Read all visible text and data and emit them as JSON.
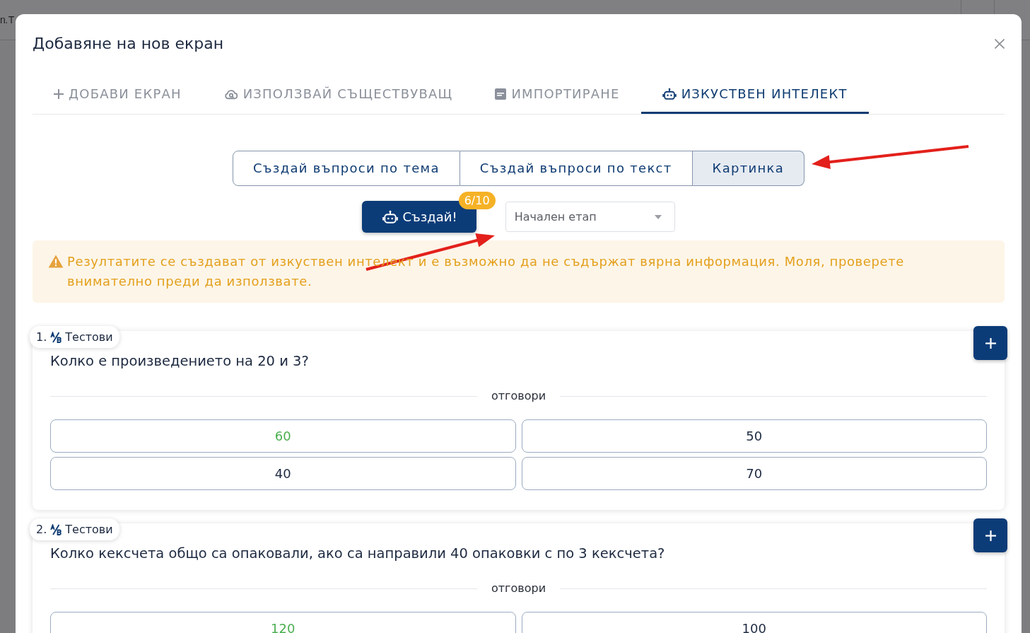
{
  "background_page": {
    "header_text": "n. T"
  },
  "dialog": {
    "title": "Добавяне на нов екран"
  },
  "tabs": [
    {
      "kind": "add",
      "label": "ДОБАВИ ЕКРАН",
      "selected": false
    },
    {
      "kind": "reuse",
      "label": "ИЗПОЛЗВАЙ СЪЩЕСТВУВАЩ",
      "selected": false
    },
    {
      "kind": "import",
      "label": "ИМПОРТИРАНЕ",
      "selected": false
    },
    {
      "kind": "ai",
      "label": "ИЗКУСТВЕН ИНТЕЛЕКТ",
      "selected": true
    }
  ],
  "mode_options": [
    {
      "label": "Създай въпроси по тема",
      "selected": false
    },
    {
      "label": "Създай въпроси по текст",
      "selected": false
    },
    {
      "label": "Картинка",
      "selected": true
    }
  ],
  "create_button": {
    "label": "Създай!",
    "badge": "6/10"
  },
  "stage_select": {
    "value": "Начален етап"
  },
  "warning": {
    "text": "Резултатите се създават от изкуствен интелект и е възможно да не съдържат вярна информация. Моля, проверете внимателно преди да използвате."
  },
  "questions": [
    {
      "number": "1.",
      "type": "Тестови",
      "text": "Колко е произведението на 20 и 3?",
      "answers_heading": "отговори",
      "answers": [
        {
          "text": "60",
          "correct": true
        },
        {
          "text": "50",
          "correct": false
        },
        {
          "text": "40",
          "correct": false
        },
        {
          "text": "70",
          "correct": false
        }
      ]
    },
    {
      "number": "2.",
      "type": "Тестови",
      "text": "Колко кексчета общо са опаковали, ако са направили 40 опаковки с по 3 кексчета?",
      "answers_heading": "отговори",
      "answers": [
        {
          "text": "120",
          "correct": true
        },
        {
          "text": "100",
          "correct": false
        }
      ]
    }
  ]
}
